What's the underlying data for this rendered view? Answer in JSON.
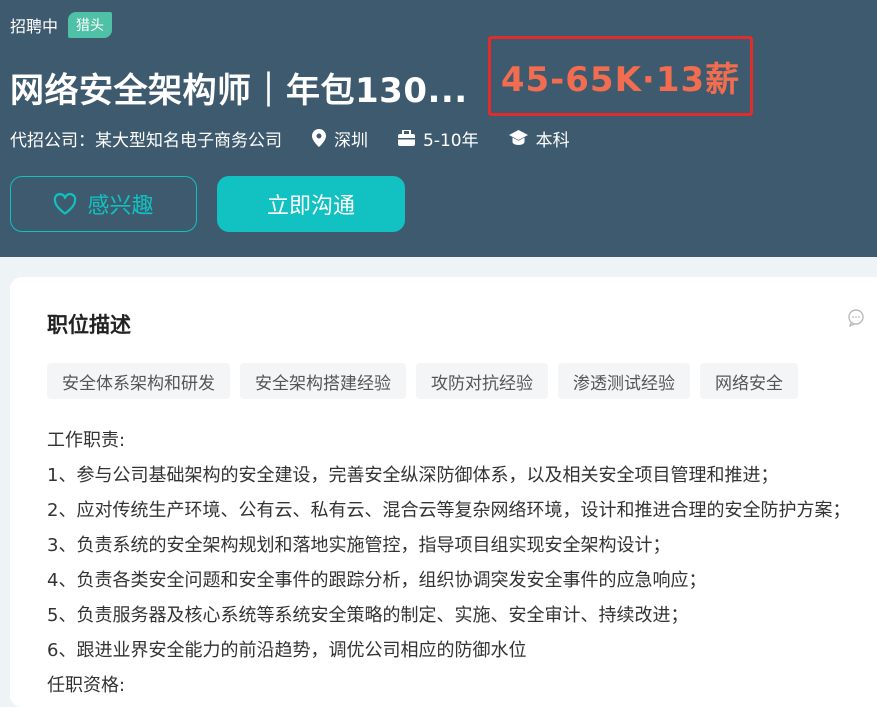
{
  "header": {
    "status": "招聘中",
    "badge": "猎头",
    "title": "网络安全架构师｜年包130...",
    "salary": "45-65K·13薪",
    "meta": {
      "company": "代招公司：某大型知名电子商务公司",
      "location": "深圳",
      "experience": "5-10年",
      "education": "本科"
    },
    "buttons": {
      "interest": "感兴趣",
      "chat": "立即沟通"
    }
  },
  "description": {
    "title": "职位描述",
    "tags": [
      "安全体系架构和研发",
      "安全架构搭建经验",
      "攻防对抗经验",
      "渗透测试经验",
      "网络安全"
    ],
    "lines": [
      "工作职责:",
      "1、参与公司基础架构的安全建设，完善安全纵深防御体系，以及相关安全项目管理和推进；",
      "2、应对传统生产环境、公有云、私有云、混合云等复杂网络环境，设计和推进合理的安全防护方案；",
      "3、负责系统的安全架构规划和落地实施管控，指导项目组实现安全架构设计；",
      "4、负责各类安全问题和安全事件的跟踪分析，组织协调突发安全事件的应急响应；",
      "5、负责服务器及核心系统等系统安全策略的制定、实施、安全审计、持续改进；",
      "6、跟进业界安全能力的前沿趋势，调优公司相应的防御水位",
      "任职资格:"
    ]
  },
  "colors": {
    "header_bg": "#3e5a6e",
    "accent": "#12c2c2",
    "salary": "#f26d4f",
    "badge": "#4fc1a7",
    "highlight_border": "#e12c2c"
  }
}
